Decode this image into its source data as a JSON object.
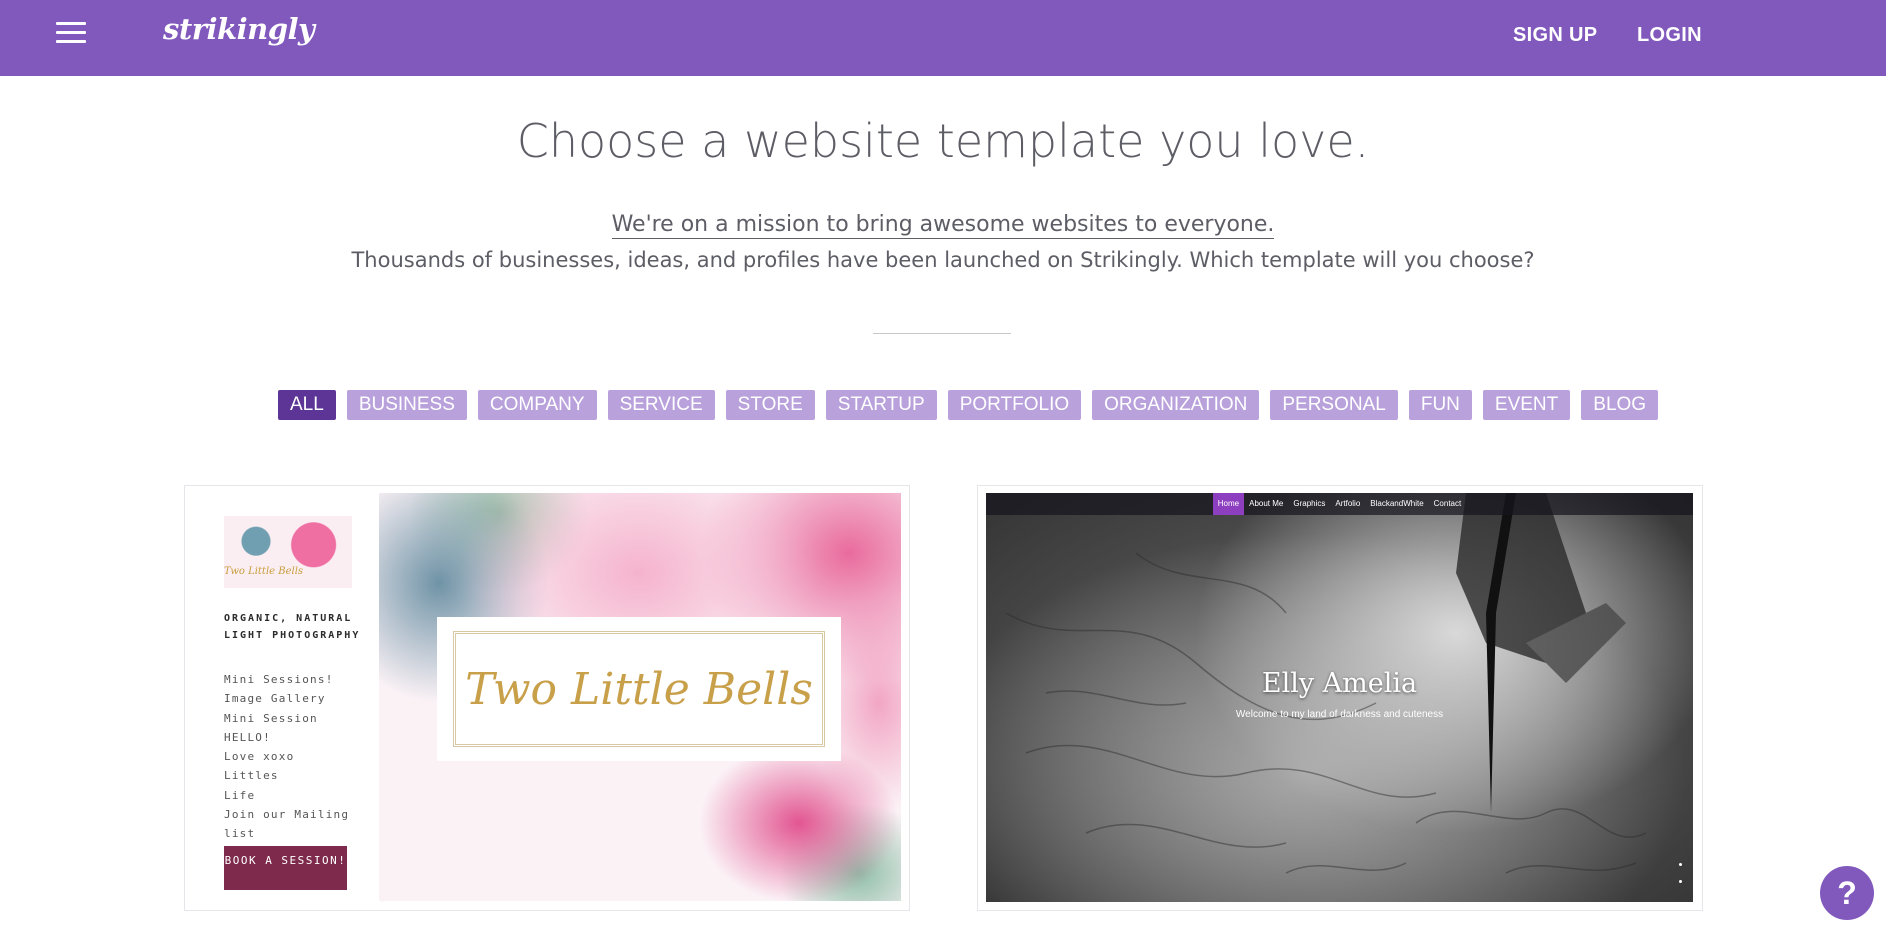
{
  "header": {
    "menu_icon": "hamburger-menu-icon",
    "logo": "strikingly",
    "signup": "SIGN UP",
    "login": "LOGIN",
    "bg_color": "#8159bd"
  },
  "hero": {
    "headline": "Choose a website template you love.",
    "mission_link": "We're on a mission to bring awesome websites to everyone.",
    "subline": "Thousands of businesses, ideas, and profiles have been launched on Strikingly. Which template will you choose?"
  },
  "filters": {
    "active_color": "#5d3596",
    "inactive_color": "#b9a1dc",
    "items": [
      {
        "label": "ALL",
        "active": true
      },
      {
        "label": "BUSINESS",
        "active": false
      },
      {
        "label": "COMPANY",
        "active": false
      },
      {
        "label": "SERVICE",
        "active": false
      },
      {
        "label": "STORE",
        "active": false
      },
      {
        "label": "STARTUP",
        "active": false
      },
      {
        "label": "PORTFOLIO",
        "active": false
      },
      {
        "label": "ORGANIZATION",
        "active": false
      },
      {
        "label": "PERSONAL",
        "active": false
      },
      {
        "label": "FUN",
        "active": false
      },
      {
        "label": "EVENT",
        "active": false
      },
      {
        "label": "BLOG",
        "active": false
      }
    ]
  },
  "templates": [
    {
      "thumb_logo": "Two Little Bells",
      "tagline": "ORGANIC, NATURAL LIGHT PHOTOGRAPHY",
      "menu": [
        "Mini Sessions!",
        "Image Gallery",
        "Mini Session",
        "HELLO!",
        "Love xoxo",
        "Littles",
        "Life",
        "Join our Mailing list"
      ],
      "button": "BOOK A SESSION!",
      "hero_logo": "Two Little Bells"
    },
    {
      "nav": [
        {
          "label": "Home",
          "active": true
        },
        {
          "label": "About Me",
          "active": false
        },
        {
          "label": "Graphics",
          "active": false
        },
        {
          "label": "Artfolio",
          "active": false
        },
        {
          "label": "BlackandWhite",
          "active": false
        },
        {
          "label": "Contact",
          "active": false
        }
      ],
      "title": "Elly Amelia",
      "subtitle": "Welcome to my land of darkness and cuteness"
    }
  ],
  "help": {
    "label": "?",
    "icon": "help-question-icon"
  }
}
